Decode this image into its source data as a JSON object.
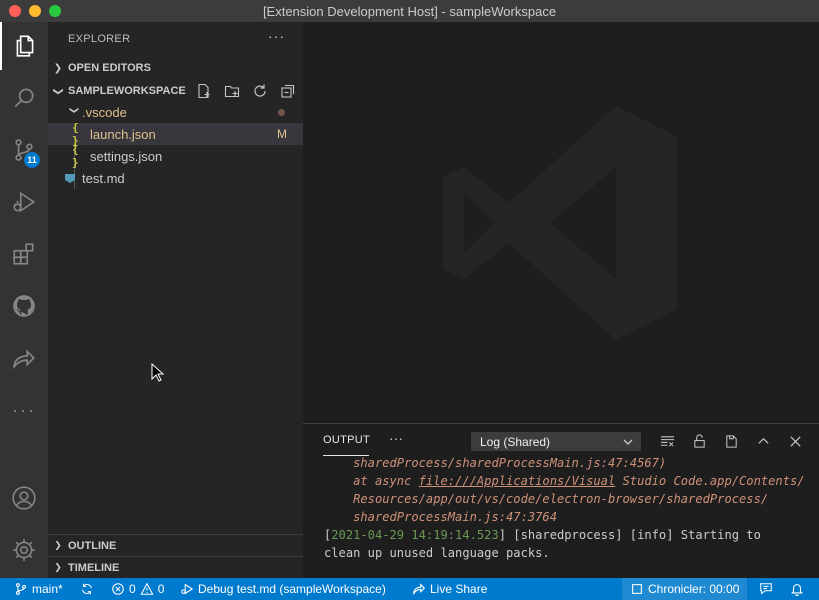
{
  "window": {
    "title": "[Extension Development Host] - sampleWorkspace"
  },
  "activity_bar": {
    "source_control_badge": "11"
  },
  "sidebar": {
    "title": "EXPLORER",
    "more": "···",
    "open_editors": "OPEN EDITORS",
    "workspace": "SAMPLEWORKSPACE",
    "tree": [
      {
        "label": ".vscode",
        "type": "folder"
      },
      {
        "label": "launch.json",
        "type": "json",
        "decoration": "M"
      },
      {
        "label": "settings.json",
        "type": "json"
      },
      {
        "label": "test.md",
        "type": "markdown"
      }
    ],
    "json_icon": "{ }",
    "outline": "OUTLINE",
    "timeline": "TIMELINE"
  },
  "panel": {
    "tab": "OUTPUT",
    "more": "···",
    "channel": "Log (Shared)",
    "log": {
      "l1": "    sharedProcess/sharedProcessMain.js:47:4567)",
      "l2a": "    at async ",
      "l2b": "file:///Applications/Visual",
      "l2c": " Studio Code.app/Contents/",
      "l3": "    Resources/app/out/vs/code/electron-browser/sharedProcess/",
      "l4": "    sharedProcessMain.js:47:3764",
      "l5a": "[",
      "l5b": "2021-04-29 14:19:14.523",
      "l5c": "] [sharedprocess] [info] Starting to",
      "l6": "clean up unused language packs."
    }
  },
  "status_bar": {
    "branch": "main*",
    "errors": "0",
    "warnings": "0",
    "debug": "Debug test.md (sampleWorkspace)",
    "live_share": "Live Share",
    "chronicler": "Chronicler: 00:00"
  },
  "colors": {
    "accent": "#007acc",
    "modified": "#e2c08d",
    "json_icon": "#cbcb41"
  }
}
